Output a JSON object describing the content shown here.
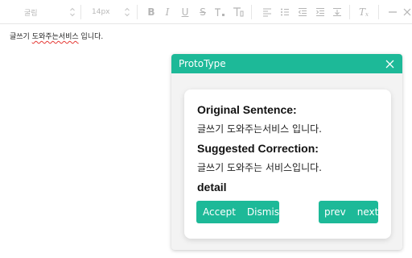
{
  "toolbar": {
    "font_family_value": "굴림",
    "font_size_value": "14px",
    "icons": [
      "bold-icon",
      "italic-icon",
      "underline-icon",
      "strikethrough-icon",
      "superscript-icon",
      "text-color-icon",
      "align-left-icon",
      "bullet-list-icon",
      "outdent-icon",
      "indent-icon",
      "vertical-align-icon",
      "clear-format-icon",
      "horizontal-rule-icon",
      "close-icon"
    ]
  },
  "editor": {
    "text_before": "글쓰기 ",
    "text_flagged": "도와주는서비스",
    "text_after": " 입니다."
  },
  "popup": {
    "title": "ProtoType",
    "original_label": "Original Sentence:",
    "original_text": "글쓰기 도와주는서비스 입니다.",
    "suggested_label": "Suggested Correction:",
    "suggested_text": "글쓰기 도와주는 서비스입니다.",
    "detail_label": "detail",
    "accept_label": "Accept",
    "dismiss_label": "Dismiss",
    "prev_label": "prev",
    "next_label": "next"
  },
  "colors": {
    "accent": "#1db998",
    "squiggle": "#e53935"
  }
}
